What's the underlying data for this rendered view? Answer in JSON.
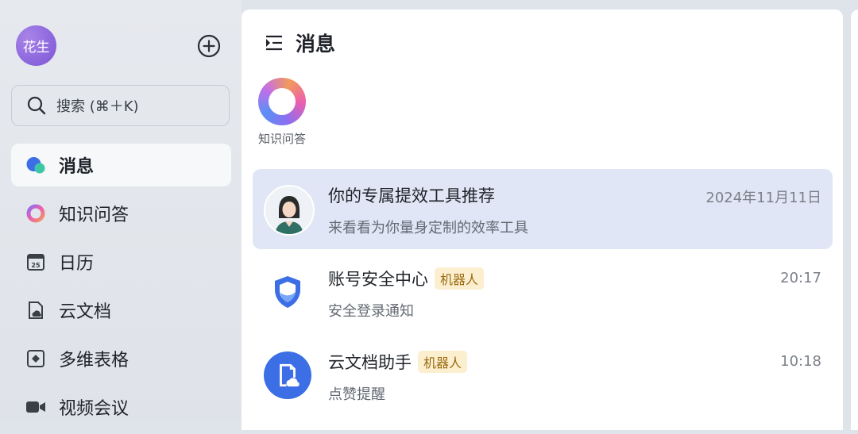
{
  "user": {
    "avatar_text": "花生"
  },
  "search": {
    "placeholder": "搜索 (⌘＋K)"
  },
  "sidebar": {
    "items": [
      {
        "label": "消息",
        "icon": "chat-bubble-icon",
        "active": true
      },
      {
        "label": "知识问答",
        "icon": "knowledge-ring-icon"
      },
      {
        "label": "日历",
        "icon": "calendar-icon"
      },
      {
        "label": "云文档",
        "icon": "cloud-doc-icon"
      },
      {
        "label": "多维表格",
        "icon": "base-table-icon"
      },
      {
        "label": "视频会议",
        "icon": "video-camera-icon"
      }
    ]
  },
  "main": {
    "title": "消息",
    "pinned": {
      "label": "知识问答"
    },
    "messages": [
      {
        "name": "你的专属提效工具推荐",
        "preview": "来看看为你量身定制的效率工具",
        "time": "2024年11月11日",
        "badge": ""
      },
      {
        "name": "账号安全中心",
        "preview": "安全登录通知",
        "time": "20:17",
        "badge": "机器人"
      },
      {
        "name": "云文档助手",
        "preview": "点赞提醒",
        "time": "10:18",
        "badge": "机器人"
      }
    ]
  },
  "colors": {
    "accent": "#3c6ee6",
    "selected_row": "#e0e6f5",
    "badge_bg": "#fcefd0",
    "badge_text": "#9a6a10"
  }
}
